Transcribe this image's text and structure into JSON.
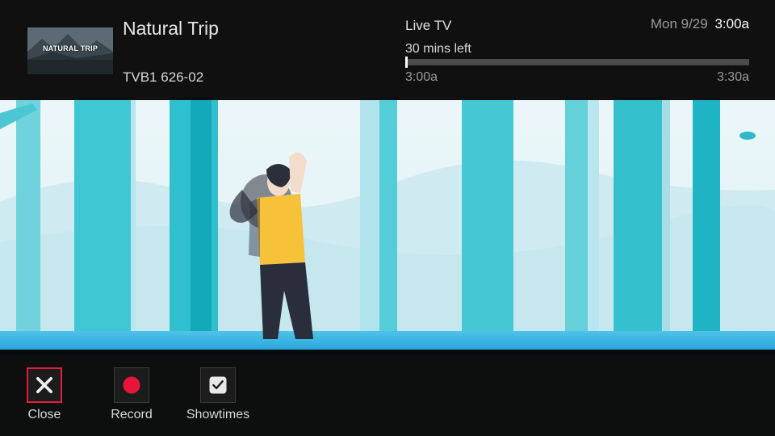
{
  "program": {
    "title": "Natural Trip",
    "channel": "TVB1 626-02",
    "thumbnail_text": "NATURAL TRIP"
  },
  "live": {
    "label": "Live TV",
    "remaining": "30 mins left",
    "start": "3:00a",
    "end": "3:30a",
    "progress": 0.0
  },
  "clock": {
    "date": "Mon 9/29",
    "time": "3:00a"
  },
  "actions": [
    {
      "label": "Close",
      "icon": "close-icon",
      "focused": true
    },
    {
      "label": "Record",
      "icon": "record-icon"
    },
    {
      "label": "Showtimes",
      "icon": "clock-icon"
    }
  ],
  "colors": {
    "focus": "#e01e3c",
    "record": "#e8153a",
    "sky": "#e9f6f8",
    "tree": "#26c3cf"
  }
}
